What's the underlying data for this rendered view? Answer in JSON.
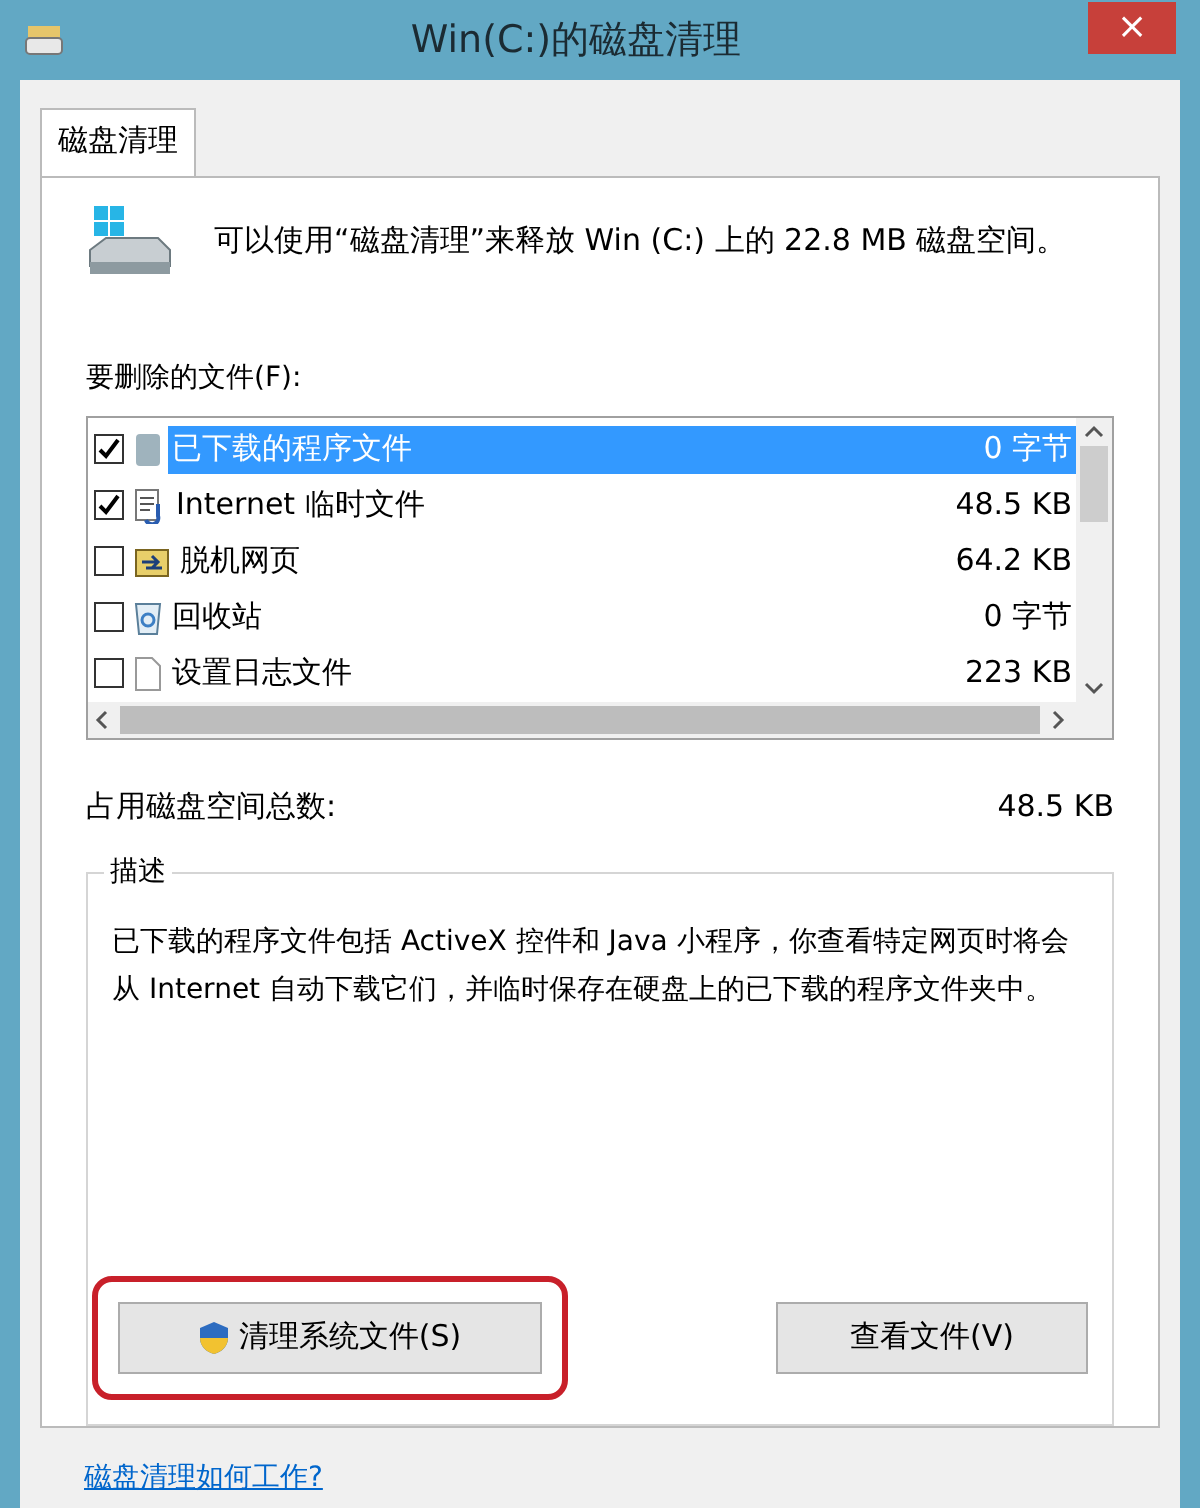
{
  "window": {
    "title": "Win(C:)的磁盘清理",
    "close": "×"
  },
  "tabs": [
    {
      "label": "磁盘清理",
      "selected": true
    }
  ],
  "intro": "可以使用“磁盘清理”来释放 Win (C:) 上的 22.8 MB 磁盘空间。",
  "files_label": "要删除的文件(F):",
  "files": [
    {
      "kind": "program",
      "name": "已下载的程序文件",
      "size": "0 字节",
      "checked": true,
      "selected": true
    },
    {
      "kind": "internet",
      "name": "Internet 临时文件",
      "size": "48.5 KB",
      "checked": true,
      "selected": false
    },
    {
      "kind": "offline",
      "name": "脱机网页",
      "size": "64.2 KB",
      "checked": false,
      "selected": false
    },
    {
      "kind": "recycle",
      "name": "回收站",
      "size": "0 字节",
      "checked": false,
      "selected": false
    },
    {
      "kind": "log",
      "name": "设置日志文件",
      "size": "223 KB",
      "checked": false,
      "selected": false
    }
  ],
  "total": {
    "label": "占用磁盘空间总数:",
    "value": "48.5 KB"
  },
  "description": {
    "title": "描述",
    "text": "已下载的程序文件包括 ActiveX 控件和 Java 小程序，你查看特定网页时将会从 Internet 自动下载它们，并临时保存在硬盘上的已下载的程序文件夹中。"
  },
  "buttons": [
    {
      "kind": "shield",
      "label": "清理系统文件(S)",
      "highlighted": true
    },
    {
      "kind": "plain",
      "label": "查看文件(V)",
      "highlighted": false
    }
  ],
  "help_link": "磁盘清理如何工作?"
}
